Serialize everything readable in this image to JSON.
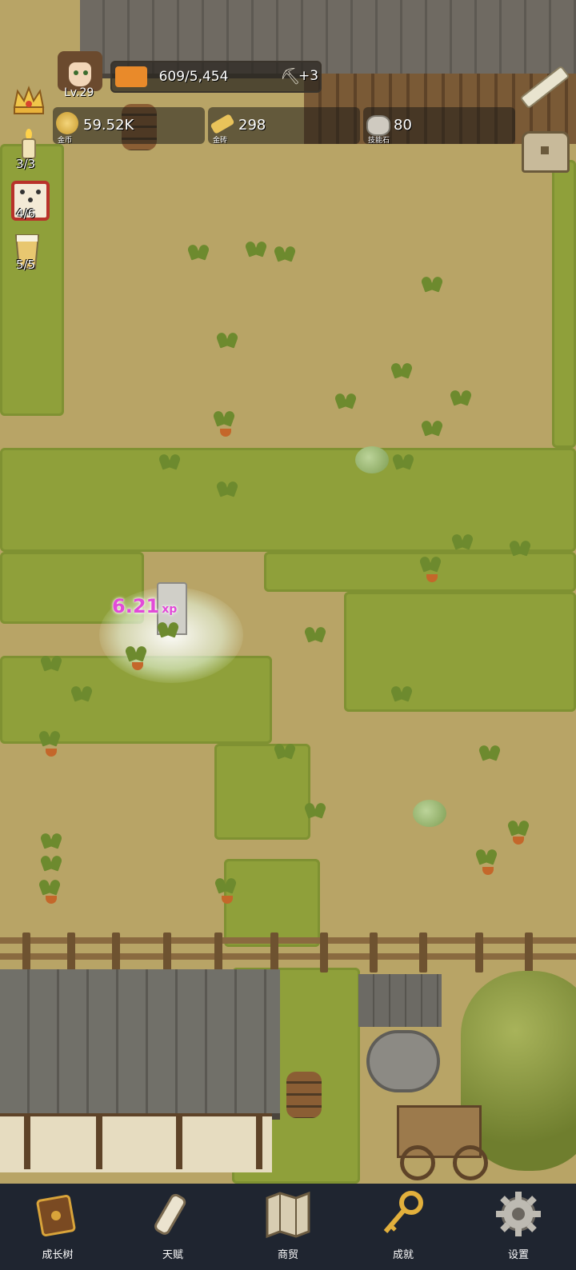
{
  "player": {
    "level": "Lv.29",
    "xp_text": "609/5,454",
    "xp_progress": 0.112,
    "xp_bonus": "+3"
  },
  "resources": {
    "gold": {
      "value": "59.52K",
      "label": "金币"
    },
    "gold_bar": {
      "value": "298",
      "label": "金砖"
    },
    "skill_stone": {
      "value": "80",
      "label": "技能石"
    }
  },
  "side_items": {
    "candle": {
      "value": "3/3"
    },
    "dice": {
      "value": "4/6"
    },
    "drink": {
      "value": "5/5"
    }
  },
  "floating_text": {
    "value": "6.21",
    "unit": "xp"
  },
  "nav": {
    "items": [
      {
        "label": "成长树",
        "icon": "book-icon"
      },
      {
        "label": "天赋",
        "icon": "scroll-icon"
      },
      {
        "label": "商贸",
        "icon": "map-icon"
      },
      {
        "label": "成就",
        "icon": "key-icon"
      },
      {
        "label": "设置",
        "icon": "gear-icon"
      }
    ]
  },
  "colors": {
    "nav_bg": "#1f2530",
    "xp_fill": "#e98a2a",
    "xp_float": "#e24ad8",
    "grass": "#8fa03a",
    "dirt": "#b8a466"
  }
}
